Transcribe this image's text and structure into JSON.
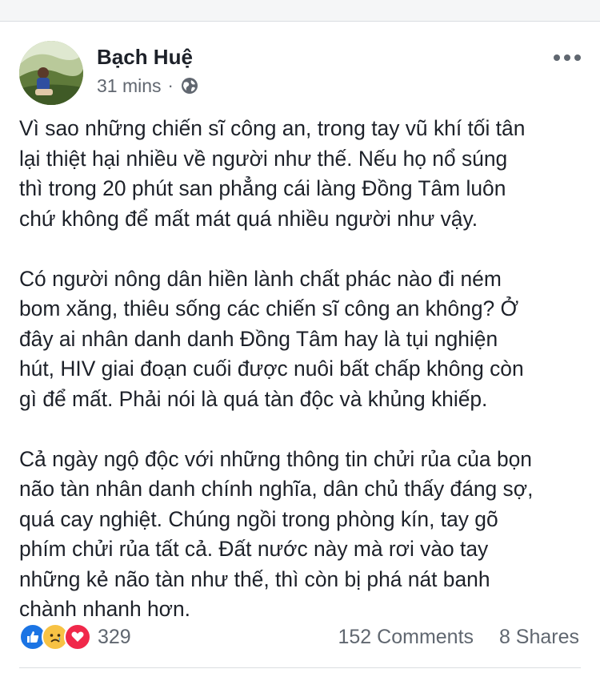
{
  "post": {
    "author": "Bạch Huệ",
    "timestamp": "31 mins",
    "separator": "·",
    "privacy_icon": "globe-icon",
    "menu_icon": "more-options-icon",
    "paragraphs": [
      [
        "Vì sao những chiến sĩ công an, trong tay vũ khí tối tân",
        "lại thiệt hại nhiều về người như thế. Nếu họ nổ súng",
        "thì trong 20 phút san phẳng cái làng Đồng Tâm luôn",
        "chứ không để mất mát quá nhiều người như vậy."
      ],
      [
        "Có người nông dân hiền lành chất phác nào đi ném",
        "bom xăng, thiêu sống các chiến sĩ công an không? Ở",
        "đây ai nhân danh danh Đồng Tâm hay là tụi nghiện",
        "hút, HIV giai đoạn cuối được nuôi bất chấp không còn",
        "gì để mất. Phải nói là quá tàn độc và khủng khiếp."
      ],
      [
        "Cả ngày ngộ độc với những thông tin chửi rủa của bọn",
        "não tàn nhân danh chính nghĩa, dân chủ thấy đáng sợ,",
        "quá cay nghiệt. Chúng ngồi trong phòng kín, tay gõ",
        "phím chửi rủa tất cả. Đất nước này mà rơi vào tay",
        "những kẻ não tàn như thế, thì còn bị phá nát banh",
        "chành nhanh hơn."
      ]
    ],
    "reactions": {
      "icons": [
        "like-reaction-icon",
        "sad-reaction-icon",
        "love-reaction-icon"
      ],
      "count": "329"
    },
    "comments": "152 Comments",
    "shares": "8 Shares"
  },
  "colors": {
    "like": "#1b74e4",
    "sad": "#f7c244",
    "love": "#f0284a",
    "text": "#1d2129",
    "meta": "#616770"
  }
}
